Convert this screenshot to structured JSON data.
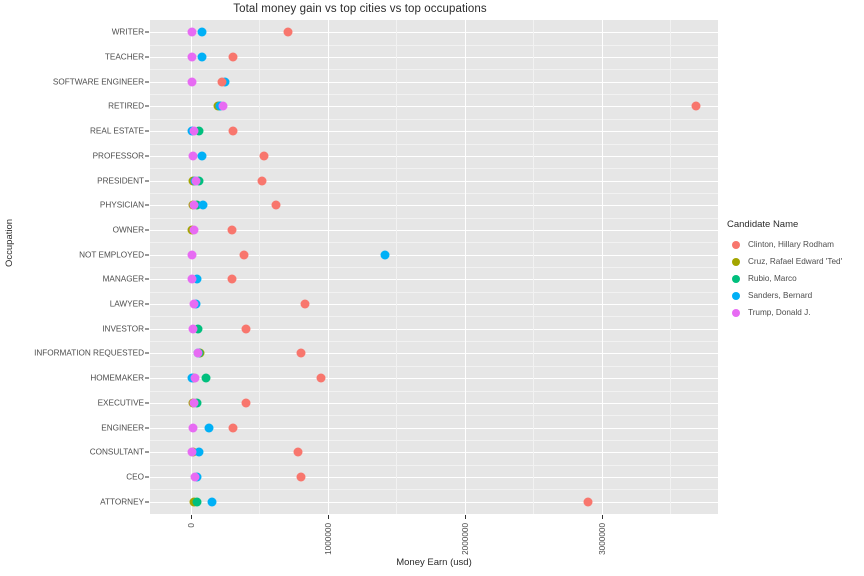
{
  "chart_data": {
    "type": "scatter",
    "title": "Total money gain vs top cities vs top occupations",
    "xlabel": "Money Earn (usd)",
    "ylabel": "Occupation",
    "xlim": [
      -300000,
      3850000
    ],
    "xticks": [
      0,
      1000000,
      2000000,
      3000000
    ],
    "xtick_labels": [
      "0",
      "1000000",
      "2000000",
      "3000000"
    ],
    "grid": true,
    "legend_position": "right",
    "legend_title": "Candidate Name",
    "categories": [
      "WRITER",
      "TEACHER",
      "SOFTWARE ENGINEER",
      "RETIRED",
      "REAL ESTATE",
      "PROFESSOR",
      "PRESIDENT",
      "PHYSICIAN",
      "OWNER",
      "NOT EMPLOYED",
      "MANAGER",
      "LAWYER",
      "INVESTOR",
      "INFORMATION REQUESTED",
      "HOMEMAKER",
      "EXECUTIVE",
      "ENGINEER",
      "CONSULTANT",
      "CEO",
      "ATTORNEY"
    ],
    "series": [
      {
        "name": "Clinton, Hillary Rodham",
        "color": "#F8766D",
        "points": [
          {
            "category": "WRITER",
            "x": 705000
          },
          {
            "category": "TEACHER",
            "x": 310000
          },
          {
            "category": "SOFTWARE ENGINEER",
            "x": 225000
          },
          {
            "category": "RETIRED",
            "x": 3690000
          },
          {
            "category": "REAL ESTATE",
            "x": 310000
          },
          {
            "category": "PROFESSOR",
            "x": 530000
          },
          {
            "category": "PRESIDENT",
            "x": 520000
          },
          {
            "category": "PHYSICIAN",
            "x": 620000
          },
          {
            "category": "OWNER",
            "x": 300000
          },
          {
            "category": "NOT EMPLOYED",
            "x": 390000
          },
          {
            "category": "MANAGER",
            "x": 300000
          },
          {
            "category": "LAWYER",
            "x": 830000
          },
          {
            "category": "INVESTOR",
            "x": 400000
          },
          {
            "category": "INFORMATION REQUESTED",
            "x": 800000
          },
          {
            "category": "HOMEMAKER",
            "x": 950000
          },
          {
            "category": "EXECUTIVE",
            "x": 400000
          },
          {
            "category": "ENGINEER",
            "x": 310000
          },
          {
            "category": "CONSULTANT",
            "x": 780000
          },
          {
            "category": "CEO",
            "x": 800000
          },
          {
            "category": "ATTORNEY",
            "x": 2900000
          }
        ]
      },
      {
        "name": "Cruz, Rafael Edward 'Ted'",
        "color": "#A3A500",
        "points": [
          {
            "category": "RETIRED",
            "x": 195000
          },
          {
            "category": "PRESIDENT",
            "x": 15000
          },
          {
            "category": "PHYSICIAN",
            "x": 12000
          },
          {
            "category": "OWNER",
            "x": 10000
          },
          {
            "category": "INFORMATION REQUESTED",
            "x": 62000
          },
          {
            "category": "HOMEMAKER",
            "x": 22000
          },
          {
            "category": "EXECUTIVE",
            "x": 12000
          },
          {
            "category": "CONSULTANT",
            "x": 14000
          },
          {
            "category": "ATTORNEY",
            "x": 20000
          }
        ]
      },
      {
        "name": "Rubio, Marco",
        "color": "#00BF7D",
        "points": [
          {
            "category": "RETIRED",
            "x": 210000
          },
          {
            "category": "REAL ESTATE",
            "x": 55000
          },
          {
            "category": "PRESIDENT",
            "x": 55000
          },
          {
            "category": "PHYSICIAN",
            "x": 45000
          },
          {
            "category": "INVESTOR",
            "x": 48000
          },
          {
            "category": "INFORMATION REQUESTED",
            "x": 58000
          },
          {
            "category": "HOMEMAKER",
            "x": 110000
          },
          {
            "category": "EXECUTIVE",
            "x": 42000
          },
          {
            "category": "ATTORNEY",
            "x": 45000
          }
        ]
      },
      {
        "name": "Sanders, Bernard",
        "color": "#00B0F6"
      },
      {
        "name": "Trump, Donald J.",
        "color": "#E76BF3"
      }
    ],
    "series_sanders_points": [
      {
        "category": "WRITER",
        "x": 80000
      },
      {
        "category": "TEACHER",
        "x": 82000
      },
      {
        "category": "SOFTWARE ENGINEER",
        "x": 250000
      },
      {
        "category": "RETIRED",
        "x": 215000
      },
      {
        "category": "REAL ESTATE",
        "x": 5000
      },
      {
        "category": "PROFESSOR",
        "x": 78000
      },
      {
        "category": "PRESIDENT",
        "x": 32000
      },
      {
        "category": "PHYSICIAN",
        "x": 85000
      },
      {
        "category": "NOT EMPLOYED",
        "x": 1420000
      },
      {
        "category": "MANAGER",
        "x": 45000
      },
      {
        "category": "LAWYER",
        "x": 35000
      },
      {
        "category": "INFORMATION REQUESTED",
        "x": 48000
      },
      {
        "category": "HOMEMAKER",
        "x": 5000
      },
      {
        "category": "ENGINEER",
        "x": 130000
      },
      {
        "category": "CONSULTANT",
        "x": 60000
      },
      {
        "category": "CEO",
        "x": 40000
      },
      {
        "category": "ATTORNEY",
        "x": 155000
      }
    ],
    "series_trump_points": [
      {
        "category": "WRITER",
        "x": 10000
      },
      {
        "category": "TEACHER",
        "x": 8000
      },
      {
        "category": "SOFTWARE ENGINEER",
        "x": 8000
      },
      {
        "category": "RETIRED",
        "x": 235000
      },
      {
        "category": "REAL ESTATE",
        "x": 22000
      },
      {
        "category": "PROFESSOR",
        "x": 12000
      },
      {
        "category": "PRESIDENT",
        "x": 35000
      },
      {
        "category": "PHYSICIAN",
        "x": 25000
      },
      {
        "category": "OWNER",
        "x": 22000
      },
      {
        "category": "NOT EMPLOYED",
        "x": 8000
      },
      {
        "category": "MANAGER",
        "x": 10000
      },
      {
        "category": "LAWYER",
        "x": 20000
      },
      {
        "category": "INVESTOR",
        "x": 15000
      },
      {
        "category": "INFORMATION REQUESTED",
        "x": 48000
      },
      {
        "category": "HOMEMAKER",
        "x": 28000
      },
      {
        "category": "EXECUTIVE",
        "x": 22000
      },
      {
        "category": "ENGINEER",
        "x": 14000
      },
      {
        "category": "CONSULTANT",
        "x": 10000
      },
      {
        "category": "CEO",
        "x": 30000
      }
    ]
  },
  "legend": {
    "title": "Candidate Name",
    "items": [
      {
        "label": "Clinton, Hillary Rodham",
        "color": "#F8766D"
      },
      {
        "label": "Cruz, Rafael Edward 'Ted'",
        "color": "#A3A500"
      },
      {
        "label": "Rubio, Marco",
        "color": "#00BF7D"
      },
      {
        "label": "Sanders, Bernard",
        "color": "#00B0F6"
      },
      {
        "label": "Trump, Donald J.",
        "color": "#E76BF3"
      }
    ]
  }
}
